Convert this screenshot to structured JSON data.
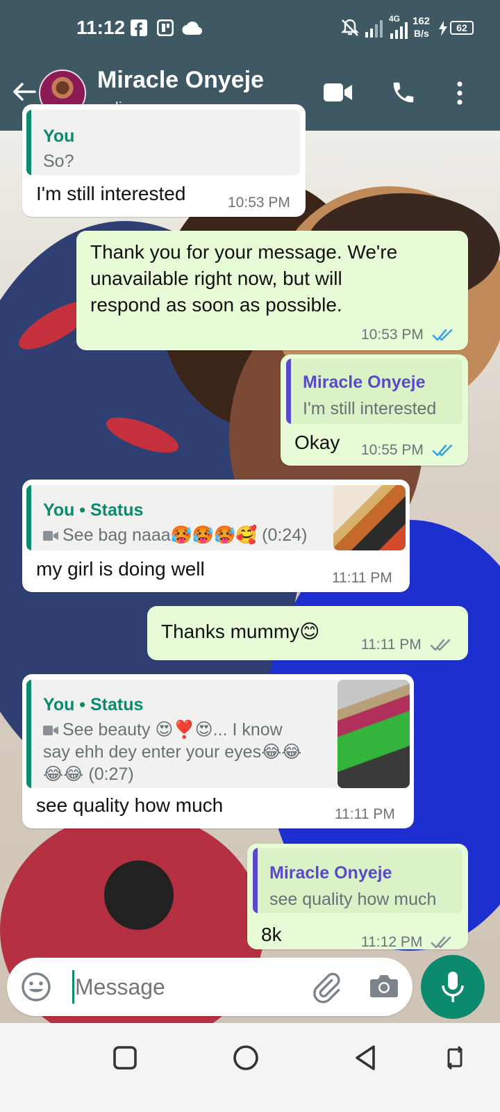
{
  "status_bar": {
    "time": "11:12",
    "network_speed_value": "162",
    "network_speed_unit": "B/s",
    "network_type": "4G",
    "battery": "62"
  },
  "header": {
    "contact_name": "Miracle Onyeje",
    "contact_status": "online"
  },
  "messages": [
    {
      "direction": "incoming",
      "quote": {
        "author": "You",
        "text": "So?"
      },
      "text": "I'm still interested",
      "time": "10:53 PM"
    },
    {
      "direction": "outgoing",
      "text_lines": [
        "Thank you for your message. We're",
        "unavailable right now, but will",
        "respond as soon as possible."
      ],
      "time": "10:53 PM",
      "status": "read"
    },
    {
      "direction": "outgoing",
      "quote": {
        "author": "Miracle Onyeje",
        "text": "I'm still interested"
      },
      "text": "Okay",
      "time": "10:55 PM",
      "status": "read"
    },
    {
      "direction": "incoming",
      "quote": {
        "author": "You • Status",
        "text": "See bag naaa🥵🥵🥵🥰 (0:24)"
      },
      "text": "my girl is doing well",
      "time": "11:11 PM"
    },
    {
      "direction": "outgoing",
      "text": "Thanks mummy😊",
      "time": "11:11 PM",
      "status": "delivered"
    },
    {
      "direction": "incoming",
      "quote": {
        "author": "You • Status",
        "text_lines": [
          "See beauty 😍❣️😍... I know",
          "say ehh dey enter your eyes😂😂",
          "😂😂 (0:27)"
        ]
      },
      "text": "see quality how much",
      "time": "11:11 PM"
    },
    {
      "direction": "outgoing",
      "quote": {
        "author": "Miracle Onyeje",
        "text": "see quality how much"
      },
      "text": "8k",
      "time": "11:12 PM",
      "status": "delivered"
    }
  ],
  "composer": {
    "placeholder": "Message"
  },
  "colors": {
    "header_bg": "#3e5864",
    "outgoing_bubble": "#e7fcd6",
    "incoming_bubble": "#ffffff",
    "accent_green": "#0b8a6e",
    "quote_purple": "#5a49c9",
    "read_tick": "#34a3e8"
  },
  "icons": [
    "facebook-icon",
    "instagram-icon",
    "cloud-icon",
    "mute-icon",
    "signal-icon",
    "battery-icon",
    "back-arrow-icon",
    "video-call-icon",
    "phone-icon",
    "more-icon",
    "emoji-icon",
    "attach-icon",
    "camera-icon",
    "mic-icon",
    "video-icon"
  ]
}
